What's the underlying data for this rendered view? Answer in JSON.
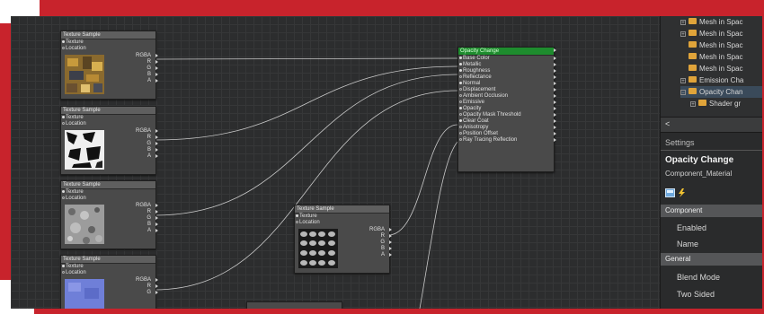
{
  "nodes": {
    "tex1": {
      "title": "Texture Sample",
      "inputs": [
        "Texture",
        "Location"
      ],
      "outputs": [
        "RGBA",
        "R",
        "G",
        "B",
        "A"
      ]
    },
    "tex2": {
      "title": "Texture Sample",
      "inputs": [
        "Texture",
        "Location"
      ],
      "outputs": [
        "RGBA",
        "R",
        "G",
        "B",
        "A"
      ]
    },
    "tex3": {
      "title": "Texture Sample",
      "inputs": [
        "Texture",
        "Location"
      ],
      "outputs": [
        "RGBA",
        "R",
        "G",
        "B",
        "A"
      ]
    },
    "tex4": {
      "title": "Texture Sample",
      "inputs": [
        "Texture",
        "Location"
      ],
      "outputs": [
        "RGBA",
        "R",
        "G"
      ]
    },
    "tex5": {
      "title": "Texture Sample",
      "inputs": [
        "Texture",
        "Location"
      ],
      "outputs": [
        "RGBA",
        "R",
        "G",
        "B",
        "A"
      ]
    },
    "opacity_change": {
      "title": "Opacity Change",
      "inputs": [
        "Base Color",
        "Metallic",
        "Roughness",
        "Reflectance",
        "Normal",
        "Displacement",
        "Ambient Occlusion",
        "Emissive",
        "Opacity",
        "Opacity Mask Threshold",
        "Clear Coat",
        "Anisotropy",
        "Position Offset",
        "Ray Tracing Reflection"
      ]
    }
  },
  "tree": {
    "items": [
      {
        "label": "Mesh in Spac",
        "expander": "+"
      },
      {
        "label": "Mesh in Spac",
        "expander": "+"
      },
      {
        "label": "Mesh in Spac",
        "expander": ""
      },
      {
        "label": "Mesh in Spac",
        "expander": ""
      },
      {
        "label": "Mesh in Spac",
        "expander": ""
      },
      {
        "label": "Emission Cha",
        "expander": "+"
      },
      {
        "label": "Opacity Chan",
        "expander": "−"
      },
      {
        "label": "Shader gr",
        "expander": "+"
      }
    ],
    "scroll_left": "<"
  },
  "settings": {
    "header": "Settings",
    "name": "Opacity Change",
    "type": "Component_Material",
    "sections": [
      {
        "label": "Component",
        "props": [
          "Enabled",
          "Name"
        ]
      },
      {
        "label": "General",
        "props": [
          "Blend Mode",
          "Two Sided"
        ]
      }
    ]
  },
  "colors": {
    "frame": "#c8232c",
    "graph_bg": "#2c2d2e",
    "node_bg": "#4a4a4a",
    "active_title": "#1e8c2e",
    "folder": "#e0a43a"
  }
}
